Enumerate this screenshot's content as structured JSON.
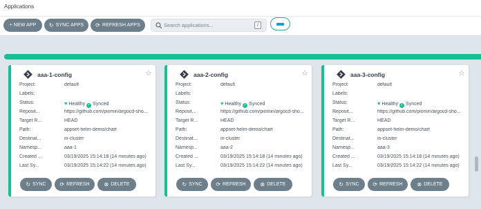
{
  "header": {
    "title": "Applications"
  },
  "toolbar": {
    "new_app": "+ NEW APP",
    "sync_apps": "SYNC APPS",
    "refresh_apps": "REFRESH APPS",
    "search_placeholder": "Search applications...",
    "search_shortcut": "/"
  },
  "progress": {
    "value": 1.0,
    "color": "#18be94"
  },
  "icons": {
    "sync": "sync-icon",
    "refresh": "refresh-icon",
    "delete": "delete-icon",
    "star": "star-icon",
    "search": "search-icon",
    "app": "argo-app-icon"
  },
  "cards": [
    {
      "name": "aaa-1-config",
      "labels": {
        "project": "Project:",
        "labels": "Labels:",
        "status": "Status:",
        "repo": "Reposit...",
        "target": "Target R...",
        "path": "Path:",
        "destination": "Destinat...",
        "namespace": "Namesp...",
        "created": "Created ...",
        "last_sync": "Last Sy..."
      },
      "project": "default",
      "labels_value": "",
      "health": "Healthy",
      "sync_status": "Synced",
      "repo": "https://github.com/piomin/argocd-sho...",
      "target": "HEAD",
      "path": "appset-helm-demo/chart",
      "destination": "in-cluster",
      "namespace": "aaa-1",
      "created": "03/19/2025 15:14:18  (14 minutes ago)",
      "last_sync": "03/19/2025 15:14:22  (14 minutes ago)",
      "actions": {
        "sync": "SYNC",
        "refresh": "REFRESH",
        "delete": "DELETE"
      }
    },
    {
      "name": "aaa-2-config",
      "labels": {
        "project": "Project:",
        "labels": "Labels:",
        "status": "Status:",
        "repo": "Reposit...",
        "target": "Target R...",
        "path": "Path:",
        "destination": "Destinat...",
        "namespace": "Namesp...",
        "created": "Created ...",
        "last_sync": "Last Sy..."
      },
      "project": "default",
      "labels_value": "",
      "health": "Healthy",
      "sync_status": "Synced",
      "repo": "https://github.com/piomin/argocd-sho...",
      "target": "HEAD",
      "path": "appset-helm-demo/chart",
      "destination": "in-cluster",
      "namespace": "aaa-2",
      "created": "03/19/2025 15:14:18  (14 minutes ago)",
      "last_sync": "03/19/2025 15:14:22  (14 minutes ago)",
      "actions": {
        "sync": "SYNC",
        "refresh": "REFRESH",
        "delete": "DELETE"
      }
    },
    {
      "name": "aaa-3-config",
      "labels": {
        "project": "Project:",
        "labels": "Labels:",
        "status": "Status:",
        "repo": "Reposit...",
        "target": "Target R...",
        "path": "Path:",
        "destination": "Destinat...",
        "namespace": "Namesp...",
        "created": "Created ...",
        "last_sync": "Last Sy..."
      },
      "project": "default",
      "labels_value": "",
      "health": "Healthy",
      "sync_status": "Synced",
      "repo": "https://github.com/piomin/argocd-sho...",
      "target": "HEAD",
      "path": "appset-helm-demo/chart",
      "destination": "in-cluster",
      "namespace": "aaa-3",
      "created": "03/19/2025 15:14:18  (14 minutes ago)",
      "last_sync": "03/19/2025 15:14:22  (14 minutes ago)",
      "actions": {
        "sync": "SYNC",
        "refresh": "REFRESH",
        "delete": "DELETE"
      }
    }
  ]
}
